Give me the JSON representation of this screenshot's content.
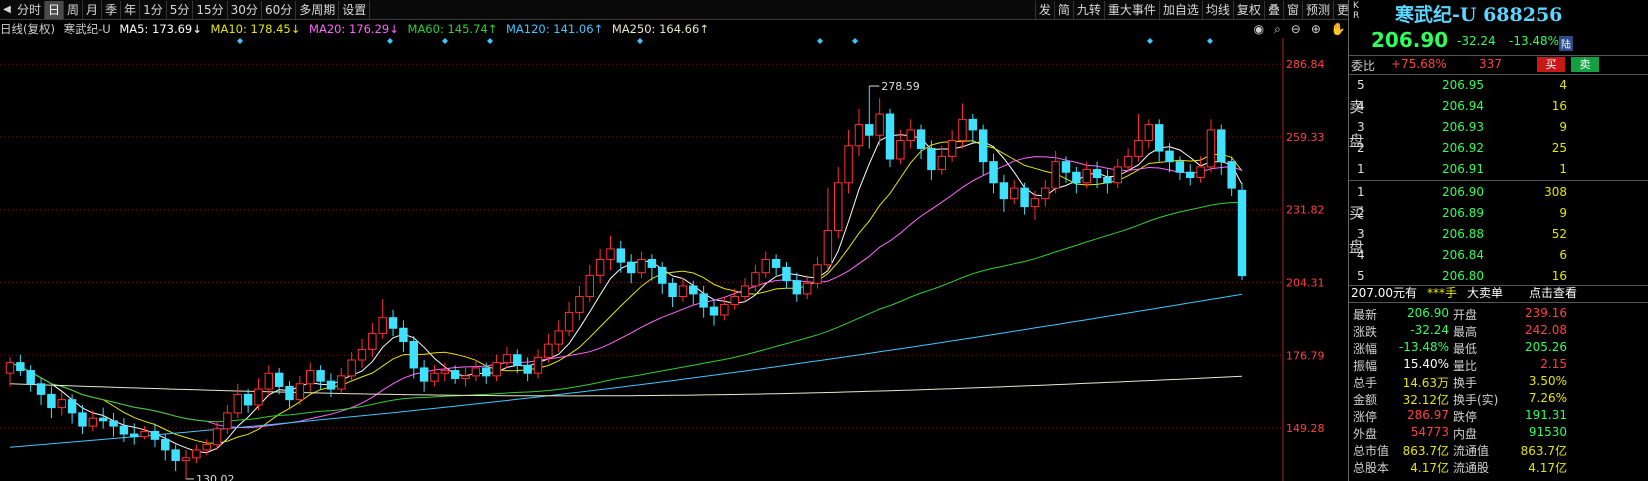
{
  "toolbar": {
    "left_buttons": [
      "分时",
      "日",
      "周",
      "月",
      "季",
      "年",
      "1分",
      "5分",
      "15分",
      "30分",
      "60分",
      "多周期",
      "设置"
    ],
    "active": "日",
    "right_buttons": [
      "发",
      "简",
      "九转",
      "重大事件",
      "加自选",
      "均线",
      "复权",
      "叠",
      "窗",
      "预测",
      "更多"
    ]
  },
  "info": {
    "period": "日线(复权)",
    "name": "寒武纪-U",
    "ma5": "MA5: 173.69↓",
    "ma10": "MA10: 178.45↓",
    "ma20": "MA20: 176.29↓",
    "ma60": "MA60: 145.74↑",
    "ma120": "MA120: 141.06↑",
    "ma250": "MA250: 164.66↑"
  },
  "colors": {
    "up": "#ff3030",
    "down": "#40e0ff",
    "ma5": "#ffffff",
    "ma10": "#e5e500",
    "ma20": "#ff66ff",
    "ma60": "#30d030",
    "ma120": "#3ec8ff",
    "ma250": "#e8e8c8"
  },
  "chart_data": {
    "type": "candlestick",
    "y_ticks": [
      286.84,
      259.33,
      231.82,
      204.31,
      176.79,
      149.28
    ],
    "ylim": [
      130.0,
      296.0
    ],
    "high_label": "278.59",
    "low_label": "130.02",
    "candles": [
      [
        170,
        174,
        165,
        176
      ],
      [
        174,
        171,
        169,
        177
      ],
      [
        171,
        166,
        163,
        173
      ],
      [
        166,
        162,
        158,
        168
      ],
      [
        162,
        157,
        153,
        165
      ],
      [
        157,
        160,
        154,
        163
      ],
      [
        160,
        155,
        151,
        162
      ],
      [
        155,
        150,
        147,
        158
      ],
      [
        150,
        153,
        148,
        156
      ],
      [
        153,
        152,
        149,
        157
      ],
      [
        152,
        150,
        146,
        155
      ],
      [
        150,
        147,
        144,
        153
      ],
      [
        147,
        146,
        143,
        151
      ],
      [
        146,
        148,
        145,
        150
      ],
      [
        148,
        145,
        142,
        151
      ],
      [
        145,
        141,
        137,
        147
      ],
      [
        141,
        137,
        133,
        143
      ],
      [
        137,
        138,
        130.02,
        141
      ],
      [
        138,
        141,
        136,
        143
      ],
      [
        141,
        143,
        139,
        145
      ],
      [
        143,
        149,
        141,
        152
      ],
      [
        149,
        155,
        147,
        158
      ],
      [
        155,
        162,
        153,
        166
      ],
      [
        162,
        158,
        155,
        164
      ],
      [
        158,
        164,
        156,
        168
      ],
      [
        164,
        170,
        161,
        173
      ],
      [
        170,
        165,
        162,
        172
      ],
      [
        165,
        160,
        157,
        167
      ],
      [
        160,
        166,
        158,
        169
      ],
      [
        166,
        171,
        163,
        174
      ],
      [
        171,
        167,
        164,
        173
      ],
      [
        167,
        164,
        161,
        170
      ],
      [
        164,
        169,
        162,
        172
      ],
      [
        169,
        175,
        167,
        178
      ],
      [
        175,
        179,
        172,
        183
      ],
      [
        179,
        185,
        176,
        189
      ],
      [
        185,
        191,
        183,
        198
      ],
      [
        191,
        187,
        184,
        194
      ],
      [
        187,
        182,
        178,
        190
      ],
      [
        182,
        172,
        168,
        184
      ],
      [
        172,
        167,
        163,
        175
      ],
      [
        167,
        170,
        165,
        173
      ],
      [
        170,
        171,
        167,
        174
      ],
      [
        171,
        168,
        166,
        173
      ],
      [
        168,
        169,
        165,
        172
      ],
      [
        169,
        172,
        167,
        175
      ],
      [
        172,
        169,
        166,
        174
      ],
      [
        169,
        174,
        167,
        177
      ],
      [
        174,
        177,
        172,
        180
      ],
      [
        177,
        173,
        170,
        179
      ],
      [
        173,
        170,
        167,
        176
      ],
      [
        170,
        176,
        168,
        179
      ],
      [
        176,
        181,
        174,
        185
      ],
      [
        181,
        186,
        178,
        190
      ],
      [
        186,
        193,
        184,
        197
      ],
      [
        193,
        199,
        190,
        203
      ],
      [
        199,
        207,
        197,
        211
      ],
      [
        207,
        213,
        204,
        217
      ],
      [
        213,
        217,
        209,
        222
      ],
      [
        217,
        212,
        208,
        220
      ],
      [
        212,
        208,
        204,
        215
      ],
      [
        208,
        213,
        206,
        216
      ],
      [
        213,
        210,
        205,
        215
      ],
      [
        210,
        204,
        200,
        212
      ],
      [
        204,
        199,
        195,
        206
      ],
      [
        199,
        203,
        197,
        206
      ],
      [
        203,
        200,
        196,
        205
      ],
      [
        200,
        195,
        191,
        203
      ],
      [
        195,
        192,
        188,
        198
      ],
      [
        192,
        196,
        190,
        199
      ],
      [
        196,
        199,
        194,
        202
      ],
      [
        199,
        203,
        197,
        206
      ],
      [
        203,
        208,
        201,
        211
      ],
      [
        208,
        213,
        206,
        216
      ],
      [
        213,
        210,
        207,
        215
      ],
      [
        210,
        205,
        202,
        212
      ],
      [
        205,
        200,
        197,
        208
      ],
      [
        200,
        204,
        198,
        207
      ],
      [
        204,
        211,
        202,
        214
      ],
      [
        211,
        224,
        209,
        240
      ],
      [
        224,
        242,
        221,
        248
      ],
      [
        242,
        256,
        238,
        262
      ],
      [
        256,
        264,
        252,
        270
      ],
      [
        264,
        260,
        255,
        278.59
      ],
      [
        260,
        268,
        256,
        274
      ],
      [
        268,
        251,
        248,
        270
      ],
      [
        251,
        258,
        249,
        262
      ],
      [
        258,
        262,
        255,
        266
      ],
      [
        262,
        255,
        251,
        264
      ],
      [
        255,
        247,
        243,
        258
      ],
      [
        247,
        252,
        245,
        256
      ],
      [
        252,
        258,
        250,
        262
      ],
      [
        258,
        266,
        255,
        272
      ],
      [
        266,
        262,
        257,
        268
      ],
      [
        262,
        250,
        245,
        264
      ],
      [
        250,
        242,
        238,
        253
      ],
      [
        242,
        236,
        231,
        245
      ],
      [
        236,
        240,
        234,
        243
      ],
      [
        240,
        233,
        230,
        242
      ],
      [
        233,
        236,
        228,
        239
      ],
      [
        236,
        240,
        233,
        243
      ],
      [
        240,
        250,
        238,
        254
      ],
      [
        250,
        246,
        242,
        252
      ],
      [
        246,
        242,
        238,
        248
      ],
      [
        242,
        247,
        240,
        250
      ],
      [
        247,
        244,
        240,
        250
      ],
      [
        244,
        242,
        238,
        247
      ],
      [
        242,
        248,
        240,
        251
      ],
      [
        248,
        252,
        246,
        255
      ],
      [
        252,
        258,
        250,
        268
      ],
      [
        258,
        264,
        255,
        266
      ],
      [
        264,
        254,
        250,
        266
      ],
      [
        254,
        250,
        246,
        257
      ],
      [
        250,
        246,
        243,
        252
      ],
      [
        246,
        244,
        241,
        249
      ],
      [
        244,
        248,
        242,
        252
      ],
      [
        248,
        262,
        246,
        266
      ],
      [
        262,
        250,
        245,
        264
      ],
      [
        250,
        240,
        237,
        252
      ],
      [
        239.16,
        206.9,
        205.26,
        242.08
      ]
    ]
  },
  "side": {
    "kr": "K R",
    "title": "寒武纪-U 688256",
    "price": "206.90",
    "change": "-32.24",
    "change_pct": "-13.48%",
    "lu": "陆",
    "weibi_label": "委比",
    "weibi": "+75.68%",
    "weicha": "337",
    "buy_btn": "买",
    "sell_btn": "卖",
    "sell_label": [
      "卖",
      "盘"
    ],
    "buy_label": [
      "买",
      "盘"
    ],
    "asks": [
      {
        "lv": "5",
        "price": "206.95",
        "vol": "4"
      },
      {
        "lv": "4",
        "price": "206.94",
        "vol": "16"
      },
      {
        "lv": "3",
        "price": "206.93",
        "vol": "9"
      },
      {
        "lv": "2",
        "price": "206.92",
        "vol": "25"
      },
      {
        "lv": "1",
        "price": "206.91",
        "vol": "1"
      }
    ],
    "bids": [
      {
        "lv": "1",
        "price": "206.90",
        "vol": "308"
      },
      {
        "lv": "2",
        "price": "206.89",
        "vol": "9"
      },
      {
        "lv": "3",
        "price": "206.88",
        "vol": "52"
      },
      {
        "lv": "4",
        "price": "206.84",
        "vol": "6"
      },
      {
        "lv": "5",
        "price": "206.80",
        "vol": "16"
      }
    ],
    "big_order": {
      "price": "207.00元有",
      "hands": "***手",
      "label": "大卖单",
      "link": "点击查看"
    },
    "stats": [
      {
        "k1": "最新",
        "v1": "206.90",
        "c1": "g",
        "k2": "开盘",
        "v2": "239.16",
        "c2": "r"
      },
      {
        "k1": "涨跌",
        "v1": "-32.24",
        "c1": "g",
        "k2": "最高",
        "v2": "242.08",
        "c2": "r"
      },
      {
        "k1": "涨幅",
        "v1": "-13.48%",
        "c1": "g",
        "k2": "最低",
        "v2": "205.26",
        "c2": "g"
      },
      {
        "k1": "振幅",
        "v1": "15.40%",
        "c1": "w",
        "k2": "量比",
        "v2": "2.15",
        "c2": "r"
      },
      {
        "k1": "总手",
        "v1": "14.63万",
        "c1": "y",
        "k2": "换手",
        "v2": "3.50%",
        "c2": "y"
      },
      {
        "k1": "金额",
        "v1": "32.12亿",
        "c1": "y",
        "k2": "换手(实)",
        "v2": "7.26%",
        "c2": "y"
      },
      {
        "k1": "涨停",
        "v1": "286.97",
        "c1": "r",
        "k2": "跌停",
        "v2": "191.31",
        "c2": "g"
      },
      {
        "k1": "外盘",
        "v1": "54773",
        "c1": "r",
        "k2": "内盘",
        "v2": "91530",
        "c2": "g"
      },
      {
        "k1": "总市值",
        "v1": "863.7亿",
        "c1": "y",
        "k2": "流通值",
        "v2": "863.7亿",
        "c2": "y"
      },
      {
        "k1": "总股本",
        "v1": "4.17亿",
        "c1": "y",
        "k2": "流通股",
        "v2": "4.17亿",
        "c2": "y"
      }
    ]
  }
}
